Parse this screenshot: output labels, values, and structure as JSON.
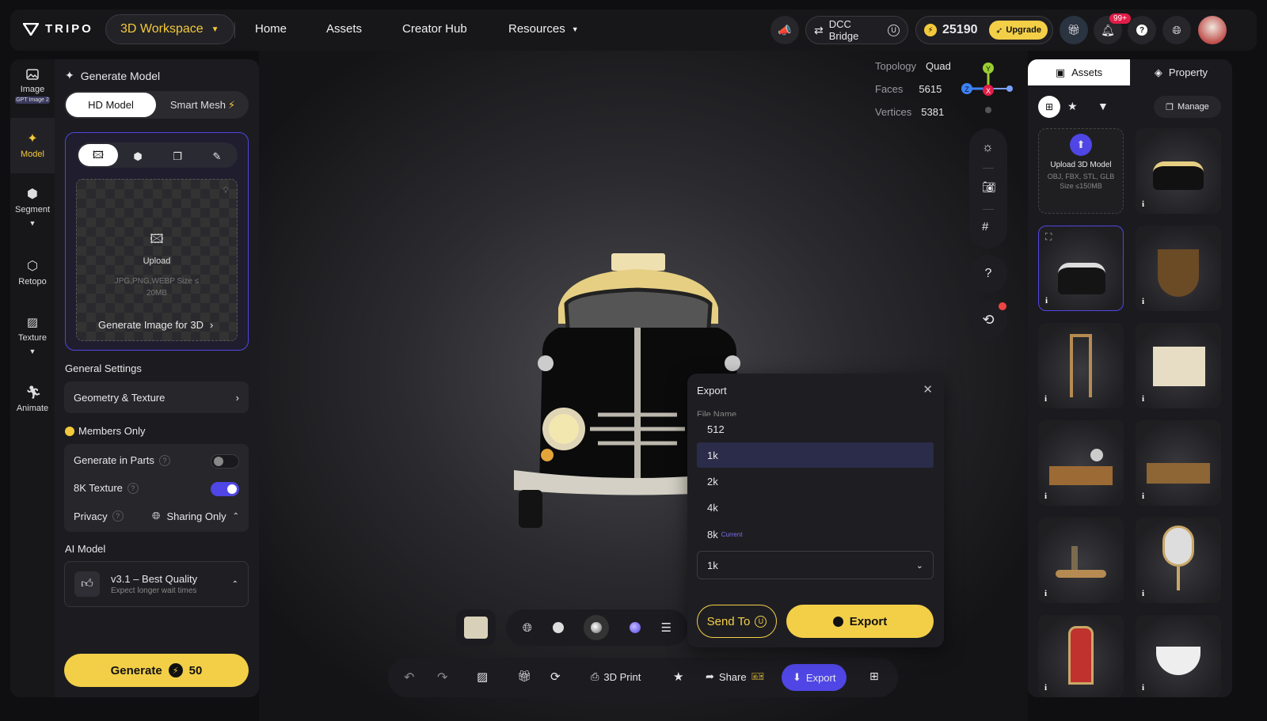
{
  "topbar": {
    "brand": "TRIPO",
    "workspace": "3D Workspace",
    "nav": [
      "Home",
      "Assets",
      "Creator Hub",
      "Resources"
    ],
    "dcc": "DCC Bridge",
    "credits": "25190",
    "upgrade": "Upgrade",
    "notif_badge": "99+"
  },
  "rail": [
    {
      "label": "Image",
      "badge": "GPT Image 2",
      "icon": "image-icon"
    },
    {
      "label": "Model",
      "icon": "sparkle-icon",
      "active": true
    },
    {
      "label": "Segment",
      "icon": "cube-icon"
    },
    {
      "label": "Retopo",
      "icon": "retopo-icon"
    },
    {
      "label": "Texture",
      "icon": "texture-icon"
    },
    {
      "label": "Animate",
      "icon": "figure-icon"
    }
  ],
  "left": {
    "title": "Generate Model",
    "mode_hd": "HD Model",
    "mode_smart": "Smart Mesh",
    "upload_label": "Upload",
    "upload_hint": "JPG,PNG,WEBP Size ≤ 20MB",
    "gen_image": "Generate Image for 3D",
    "general_settings": "General Settings",
    "geometry_texture": "Geometry & Texture",
    "members_only": "Members Only",
    "parts": "Generate in Parts",
    "texture8k": "8K Texture",
    "privacy": "Privacy",
    "privacy_value": "Sharing Only",
    "ai_model": "AI Model",
    "model_name": "v3.1 – Best Quality",
    "model_sub": "Expect longer wait times",
    "generate": "Generate",
    "cost": "50"
  },
  "stats": {
    "topology_label": "Topology",
    "topology": "Quad",
    "faces_label": "Faces",
    "faces": "5615",
    "vertices_label": "Vertices",
    "vertices": "5381"
  },
  "gizmo": {
    "y": "Y",
    "z": "Z",
    "x": "X"
  },
  "export_dialog": {
    "title": "Export",
    "file_name_label": "File Name",
    "options": [
      "512",
      "1k",
      "2k",
      "4k",
      "8k"
    ],
    "current_tag": "Current",
    "selected": "1k",
    "send_to": "Send To",
    "export": "Export"
  },
  "bottom": {
    "print": "3D Print",
    "share": "Share",
    "export": "Export"
  },
  "right": {
    "tab_assets": "Assets",
    "tab_property": "Property",
    "manage": "Manage",
    "upload_title": "Upload 3D Model",
    "upload_formats": "OBJ, FBX, STL, GLB",
    "upload_size": "Size ≤150MB",
    "info": "i",
    "tiles": [
      "car",
      "ship",
      "chair",
      "crate",
      "desk-globe",
      "desk",
      "bottles-table",
      "mirror",
      "throne",
      "teacup"
    ]
  },
  "colors": {
    "accent": "#4f46e5",
    "yellow": "#f3cf48"
  }
}
